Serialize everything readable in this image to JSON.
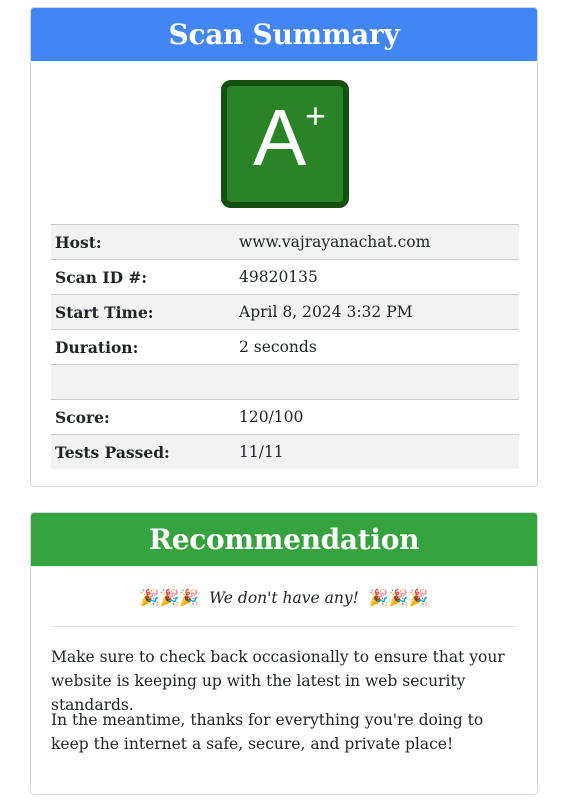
{
  "summary": {
    "title": "Scan Summary",
    "grade": {
      "letter": "A",
      "modifier": "+",
      "color": "#2a8327"
    },
    "rows": [
      {
        "key": "Host:",
        "value": "www.vajrayanachat.com"
      },
      {
        "key": "Scan ID #:",
        "value": "49820135"
      },
      {
        "key": "Start Time:",
        "value": "April 8, 2024 3:32 PM"
      },
      {
        "key": "Duration:",
        "value": "2 seconds"
      },
      {
        "key": "",
        "value": ""
      },
      {
        "key": "Score:",
        "value": "120/100"
      },
      {
        "key": "Tests Passed:",
        "value": "11/11"
      }
    ]
  },
  "recommendation": {
    "title": "Recommendation",
    "party_left": "🎉🎉🎉",
    "headline": "We don't have any!",
    "party_right": "🎉🎉🎉",
    "paragraphs": [
      "Make sure to check back occasionally to ensure that your website is keeping up with the latest in web security standards.",
      "In the meantime, thanks for everything you're doing to keep the internet a safe, secure, and private place!"
    ]
  },
  "colors": {
    "summary_header": "#4285f4",
    "recommendation_header": "#35a33e"
  }
}
